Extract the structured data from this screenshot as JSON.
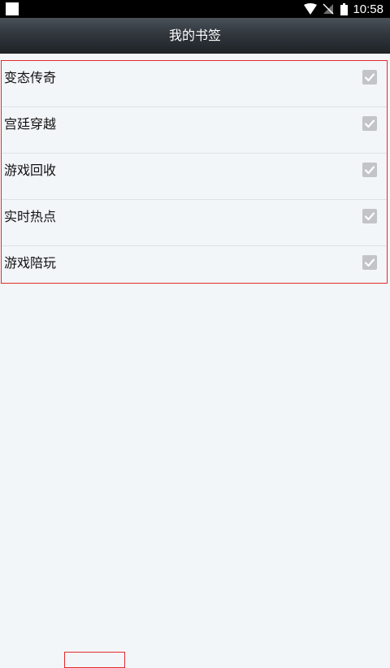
{
  "status_bar": {
    "time": "10:58",
    "icons": [
      "notification-icon",
      "wifi-icon",
      "no-signal-icon",
      "battery-icon"
    ]
  },
  "header": {
    "title": "我的书签"
  },
  "bookmarks": [
    {
      "label": "变态传奇",
      "checked": true
    },
    {
      "label": "宫廷穿越",
      "checked": true
    },
    {
      "label": "游戏回收",
      "checked": true
    },
    {
      "label": "实时热点",
      "checked": true
    },
    {
      "label": "游戏陪玩",
      "checked": true
    }
  ],
  "colors": {
    "highlight_border": "#e32b2b",
    "checkbox": "#c2c4c7",
    "background": "#f3f6f9"
  }
}
